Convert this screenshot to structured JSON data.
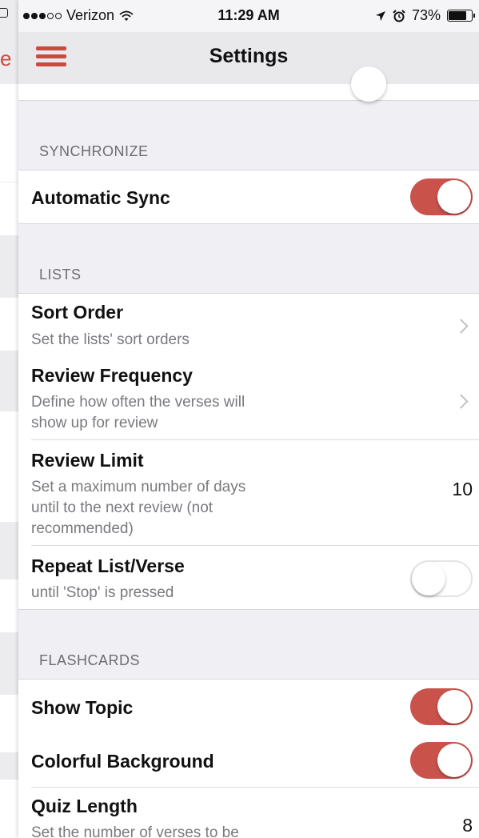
{
  "status_bar": {
    "carrier": "Verizon",
    "time": "11:29 AM",
    "battery": "73%",
    "battery_level": 0.73
  },
  "nav": {
    "title": "Settings"
  },
  "background_app": {
    "edge_letter": "e"
  },
  "sections": {
    "synchronize": {
      "header": "SYNCHRONIZE"
    },
    "lists": {
      "header": "LISTS"
    },
    "flashcards": {
      "header": "FLASHCARDS"
    }
  },
  "rows": {
    "automatic_sync": {
      "title": "Automatic Sync",
      "on": true
    },
    "sort_order": {
      "title": "Sort Order",
      "subtitle": "Set the lists' sort orders"
    },
    "review_frequency": {
      "title": "Review Frequency",
      "subtitle_line1": "Define how often the verses will",
      "subtitle_line2": "show up for review"
    },
    "review_limit": {
      "title": "Review Limit",
      "subtitle_line1": "Set a maximum number of days",
      "subtitle_line2": "until to the next review (not",
      "subtitle_line3": "recommended)",
      "value": "10"
    },
    "repeat": {
      "title": "Repeat List/Verse",
      "subtitle": "until 'Stop' is pressed",
      "on": false
    },
    "show_topic": {
      "title": "Show Topic",
      "on": true
    },
    "colorful_background": {
      "title": "Colorful Background",
      "on": true
    },
    "quiz_length": {
      "title": "Quiz Length",
      "subtitle": "Set the number of verses to be",
      "value": "8"
    }
  },
  "colors": {
    "accent": "#c9524b",
    "menu": "#d0473f"
  }
}
